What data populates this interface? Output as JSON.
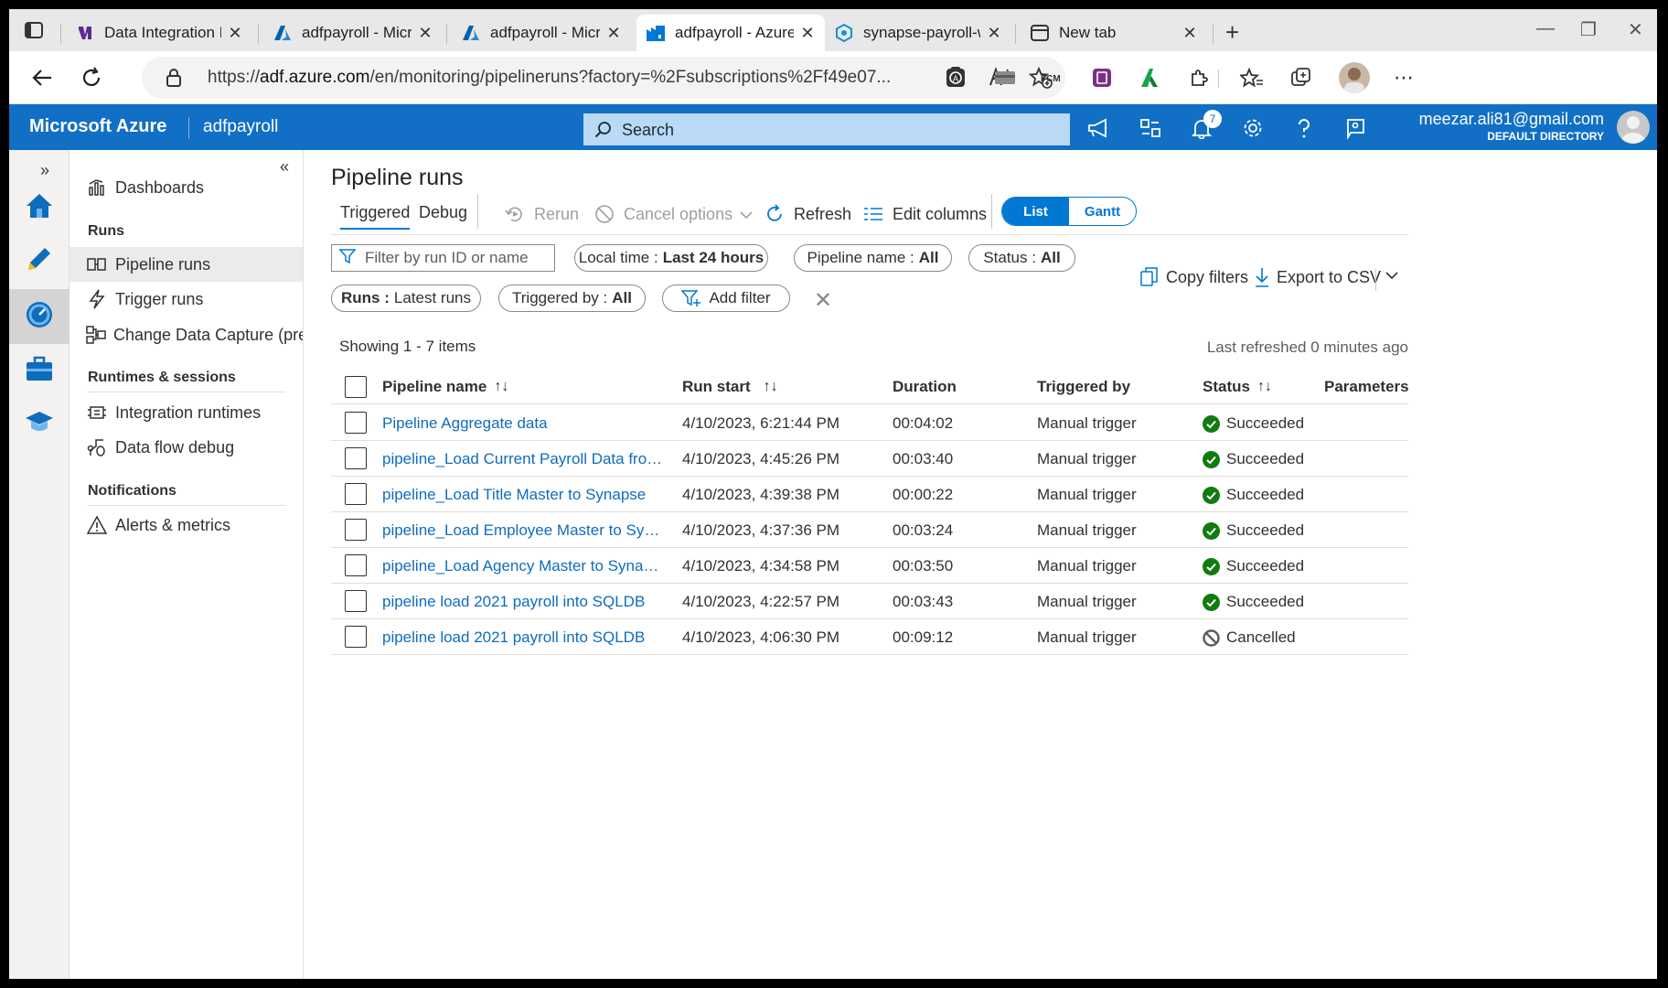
{
  "browser": {
    "tabs": [
      {
        "title": "Data Integration Pip",
        "icon": "visual-studio-icon"
      },
      {
        "title": "adfpayroll - Microso",
        "icon": "azure-icon"
      },
      {
        "title": "adfpayroll - Microso",
        "icon": "azure-icon"
      },
      {
        "title": "adfpayroll - Azure D",
        "icon": "data-factory-icon",
        "active": true
      },
      {
        "title": "synapse-payroll-ws",
        "icon": "synapse-icon"
      },
      {
        "title": "New tab",
        "icon": "new-tab-icon"
      }
    ],
    "url_prefix": "https://",
    "url_host": "adf.azure.com",
    "url_rest": "/en/monitoring/pipelineruns?factory=%2Fsubscriptions%2Ff49e07..."
  },
  "header": {
    "brand": "Microsoft Azure",
    "factory": "adfpayroll",
    "search_placeholder": "Search",
    "notification_count": "7",
    "email": "meezar.ali81@gmail.com",
    "directory": "DEFAULT DIRECTORY"
  },
  "sidenav": {
    "dashboards": "Dashboards",
    "runs_heading": "Runs",
    "pipeline_runs": "Pipeline runs",
    "trigger_runs": "Trigger runs",
    "change_data_capture": "Change Data Capture (previ...",
    "runtimes_heading": "Runtimes & sessions",
    "integration_runtimes": "Integration runtimes",
    "data_flow_debug": "Data flow debug",
    "notifications_heading": "Notifications",
    "alerts_metrics": "Alerts & metrics"
  },
  "main": {
    "title": "Pipeline runs",
    "tabs": {
      "triggered": "Triggered",
      "debug": "Debug"
    },
    "toolbar": {
      "rerun": "Rerun",
      "cancel_options": "Cancel options",
      "refresh": "Refresh",
      "edit_columns": "Edit columns",
      "list": "List",
      "gantt": "Gantt"
    },
    "filters": {
      "search_placeholder": "Filter by run ID or name",
      "local_time_label": "Local time :",
      "local_time_value": "Last 24 hours",
      "pipeline_name_label": "Pipeline name :",
      "pipeline_name_value": "All",
      "status_label": "Status :",
      "status_value": "All",
      "runs_label": "Runs :",
      "runs_value": "Latest runs",
      "triggered_by_label": "Triggered by :",
      "triggered_by_value": "All",
      "add_filter": "Add filter",
      "copy_filters": "Copy filters",
      "export_csv": "Export to CSV"
    },
    "showing": "Showing 1 - 7 items",
    "last_refreshed": "Last refreshed 0 minutes ago",
    "columns": {
      "pipeline_name": "Pipeline name",
      "run_start": "Run start",
      "duration": "Duration",
      "triggered_by": "Triggered by",
      "status": "Status",
      "parameters": "Parameters"
    },
    "rows": [
      {
        "name": "Pipeline Aggregate data",
        "start": "4/10/2023, 6:21:44 PM",
        "duration": "00:04:02",
        "trigger": "Manual trigger",
        "status": "Succeeded"
      },
      {
        "name": "pipeline_Load Current Payroll Data from S...",
        "start": "4/10/2023, 4:45:26 PM",
        "duration": "00:03:40",
        "trigger": "Manual trigger",
        "status": "Succeeded"
      },
      {
        "name": "pipeline_Load Title Master to Synapse",
        "start": "4/10/2023, 4:39:38 PM",
        "duration": "00:00:22",
        "trigger": "Manual trigger",
        "status": "Succeeded"
      },
      {
        "name": "pipeline_Load Employee Master to Synpase",
        "start": "4/10/2023, 4:37:36 PM",
        "duration": "00:03:24",
        "trigger": "Manual trigger",
        "status": "Succeeded"
      },
      {
        "name": "pipeline_Load Agency Master to Synapse",
        "start": "4/10/2023, 4:34:58 PM",
        "duration": "00:03:50",
        "trigger": "Manual trigger",
        "status": "Succeeded"
      },
      {
        "name": "pipeline load 2021 payroll into SQLDB",
        "start": "4/10/2023, 4:22:57 PM",
        "duration": "00:03:43",
        "trigger": "Manual trigger",
        "status": "Succeeded"
      },
      {
        "name": "pipeline load 2021 payroll into SQLDB",
        "start": "4/10/2023, 4:06:30 PM",
        "duration": "00:09:12",
        "trigger": "Manual trigger",
        "status": "Cancelled"
      }
    ]
  },
  "colors": {
    "azure_header": "#1170c5",
    "link": "#0f6cbd",
    "accent": "#0078d4",
    "success": "#107c10",
    "cancelled": "#605e5c"
  }
}
